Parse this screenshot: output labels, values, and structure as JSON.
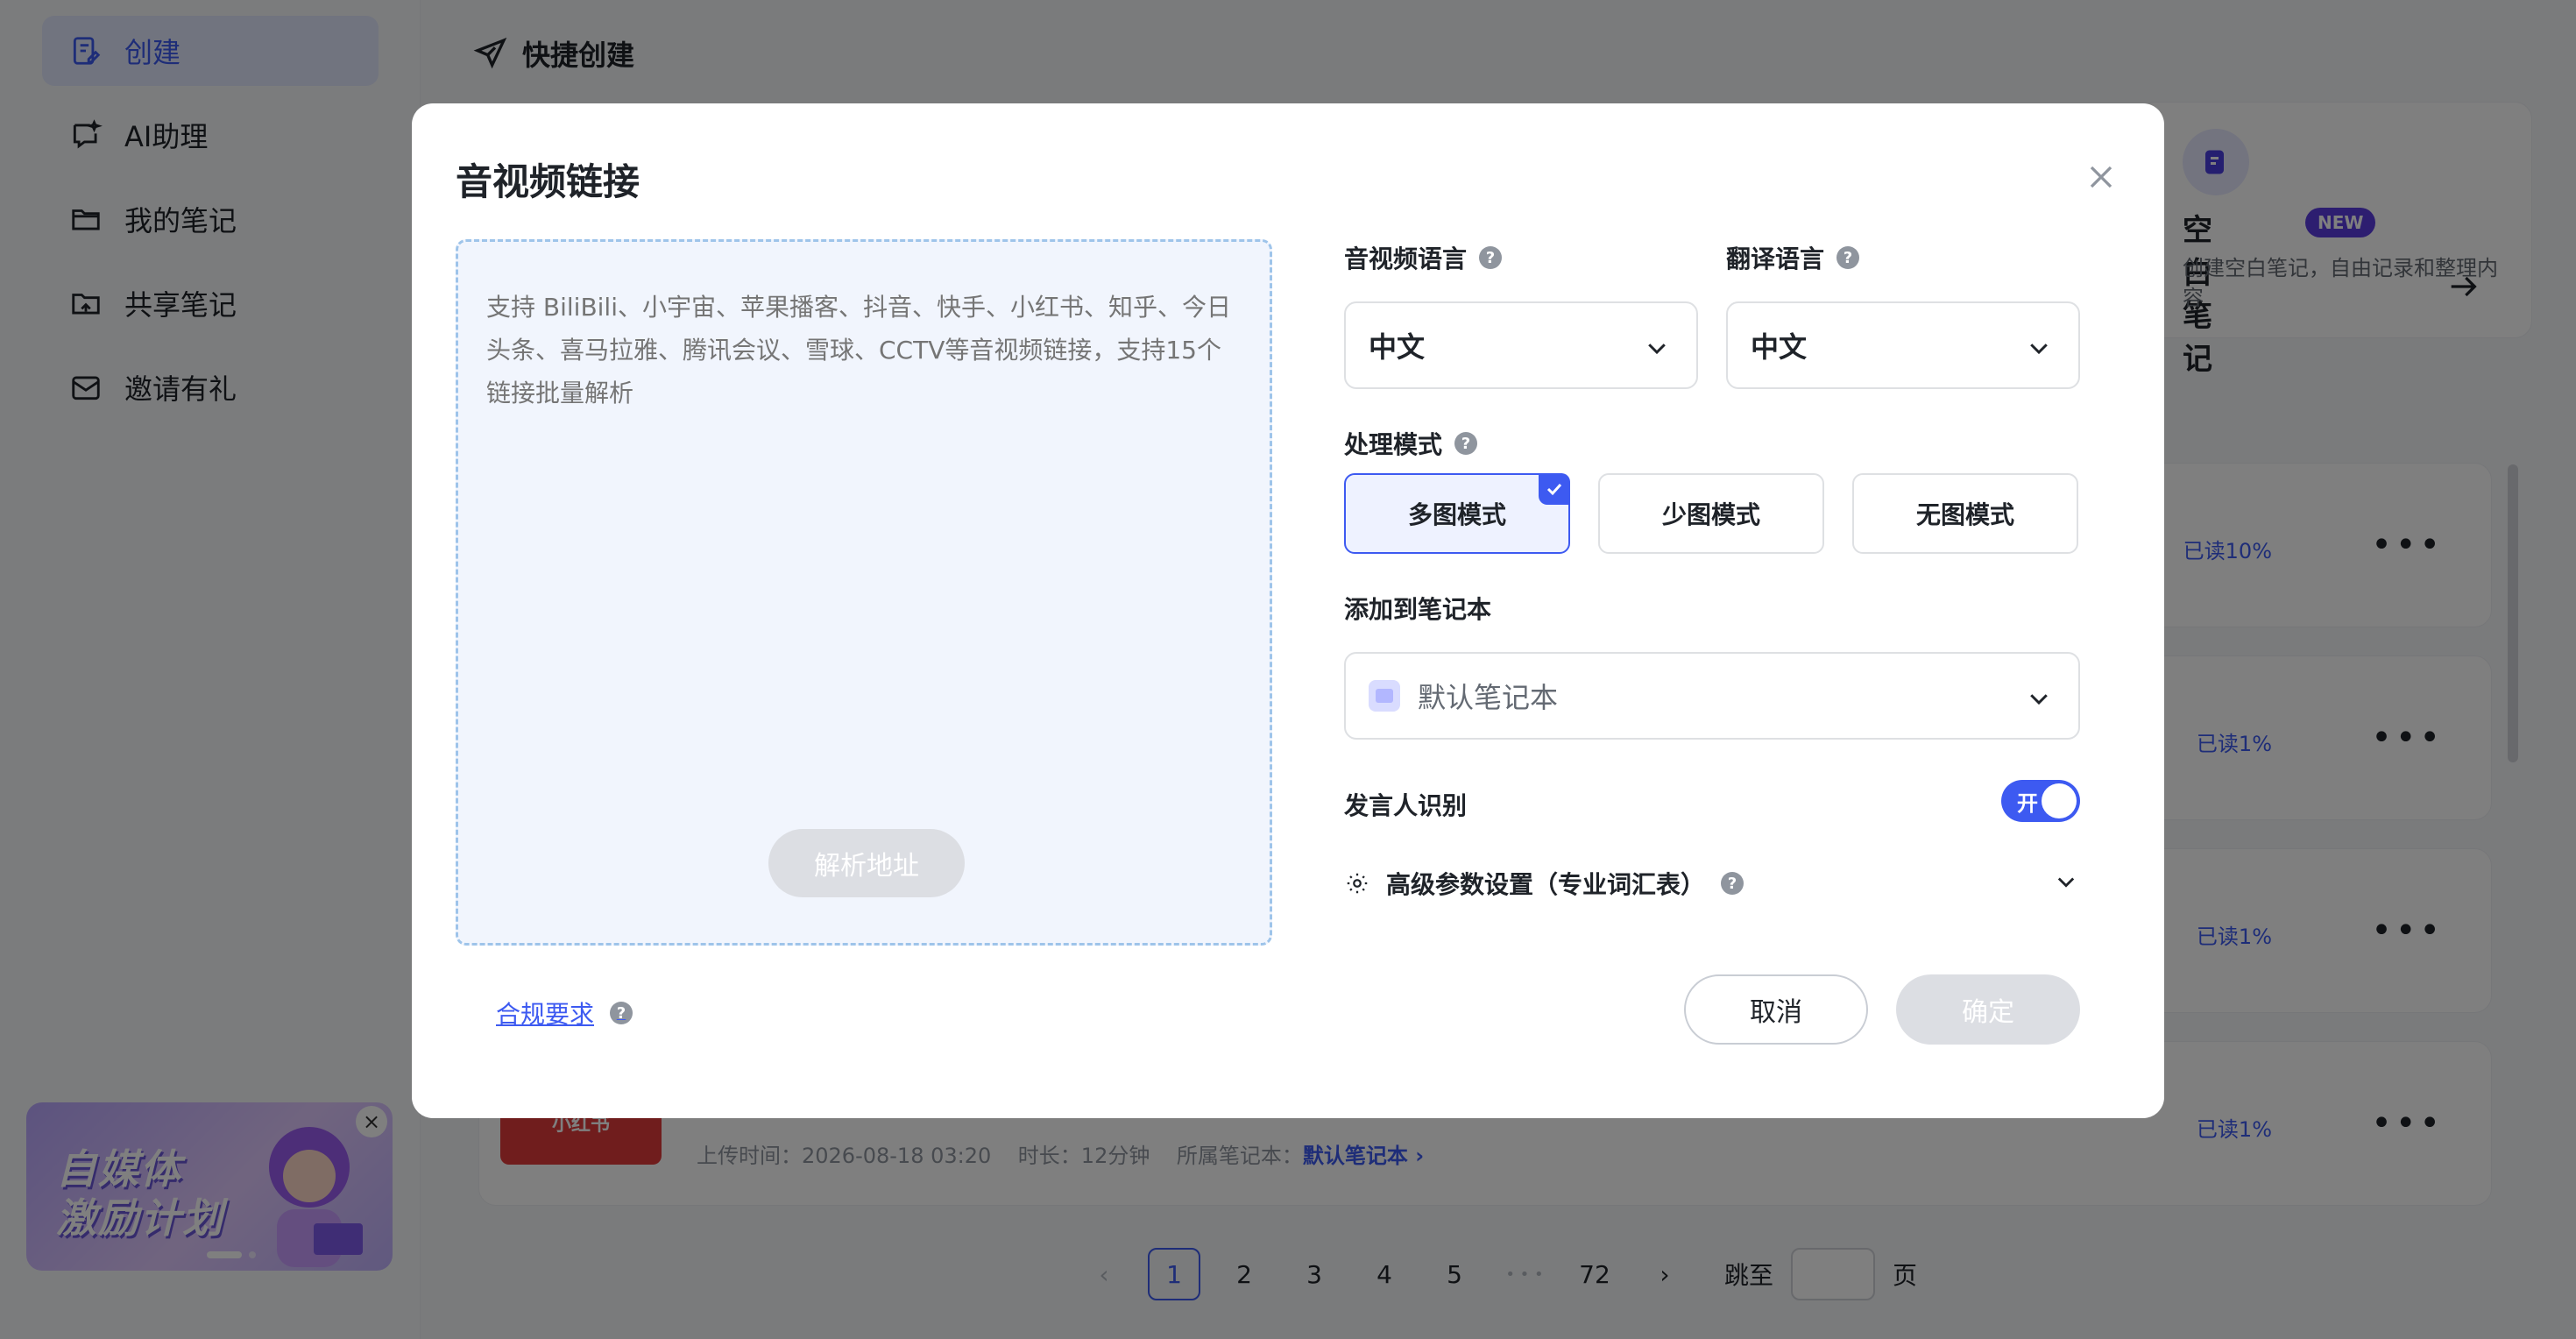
{
  "sidebar": {
    "items": [
      {
        "label": "创建",
        "icon": "create-note-icon",
        "active": true
      },
      {
        "label": "AI助理",
        "icon": "ai-chat-icon",
        "active": false
      },
      {
        "label": "我的笔记",
        "icon": "folder-icon",
        "active": false
      },
      {
        "label": "共享笔记",
        "icon": "shared-folder-icon",
        "active": false
      },
      {
        "label": "邀请有礼",
        "icon": "mail-gift-icon",
        "active": false
      }
    ],
    "promo": {
      "text": "自媒体\n激励计划",
      "close": "×"
    }
  },
  "main": {
    "title": "快捷创建",
    "blank_card": {
      "title": "空白笔记",
      "badge": "NEW",
      "desc": "创建空白笔记，自由记录和整理内容"
    },
    "rows": [
      {
        "read": "已读10%"
      },
      {
        "read": "已读1%"
      },
      {
        "read": "已读1%"
      },
      {
        "read": "已读1%",
        "thumb": "小红书",
        "upload": "上传时间：2026-08-18 03:20",
        "duration": "时长：12分钟",
        "notebook_label": "所属笔记本：",
        "notebook": "默认笔记本 ›"
      }
    ],
    "more": "•••",
    "pager": {
      "prev": "‹",
      "pages": [
        "1",
        "2",
        "3",
        "4",
        "5"
      ],
      "current": "1",
      "ellipsis": "• • •",
      "last": "72",
      "next": "›",
      "jump_label": "跳至",
      "page_suffix": "页"
    }
  },
  "modal": {
    "title": "音视频链接",
    "close": "close",
    "placeholder": "支持 BiliBili、小宇宙、苹果播客、抖音、快手、小红书、知乎、今日头条、喜马拉雅、腾讯会议、雪球、CCTV等音视频链接，支持15个链接批量解析",
    "parse_button": "解析地址",
    "compliance": "合规要求",
    "help": "?",
    "audio_lang_label": "音视频语言",
    "audio_lang_value": "中文",
    "trans_lang_label": "翻译语言",
    "trans_lang_value": "中文",
    "mode_label": "处理模式",
    "modes": [
      "多图模式",
      "少图模式",
      "无图模式"
    ],
    "selected_mode": "多图模式",
    "notebook_label": "添加到笔记本",
    "notebook_value": "默认笔记本",
    "speaker_label": "发言人识别",
    "speaker_toggle": "开",
    "advanced_label": "高级参数设置（专业词汇表）",
    "cancel": "取消",
    "confirm": "确定"
  },
  "colors": {
    "accent": "#3d5af1",
    "overlay": "rgba(0,0,0,0.5)",
    "disabled": "#dcdee3"
  }
}
